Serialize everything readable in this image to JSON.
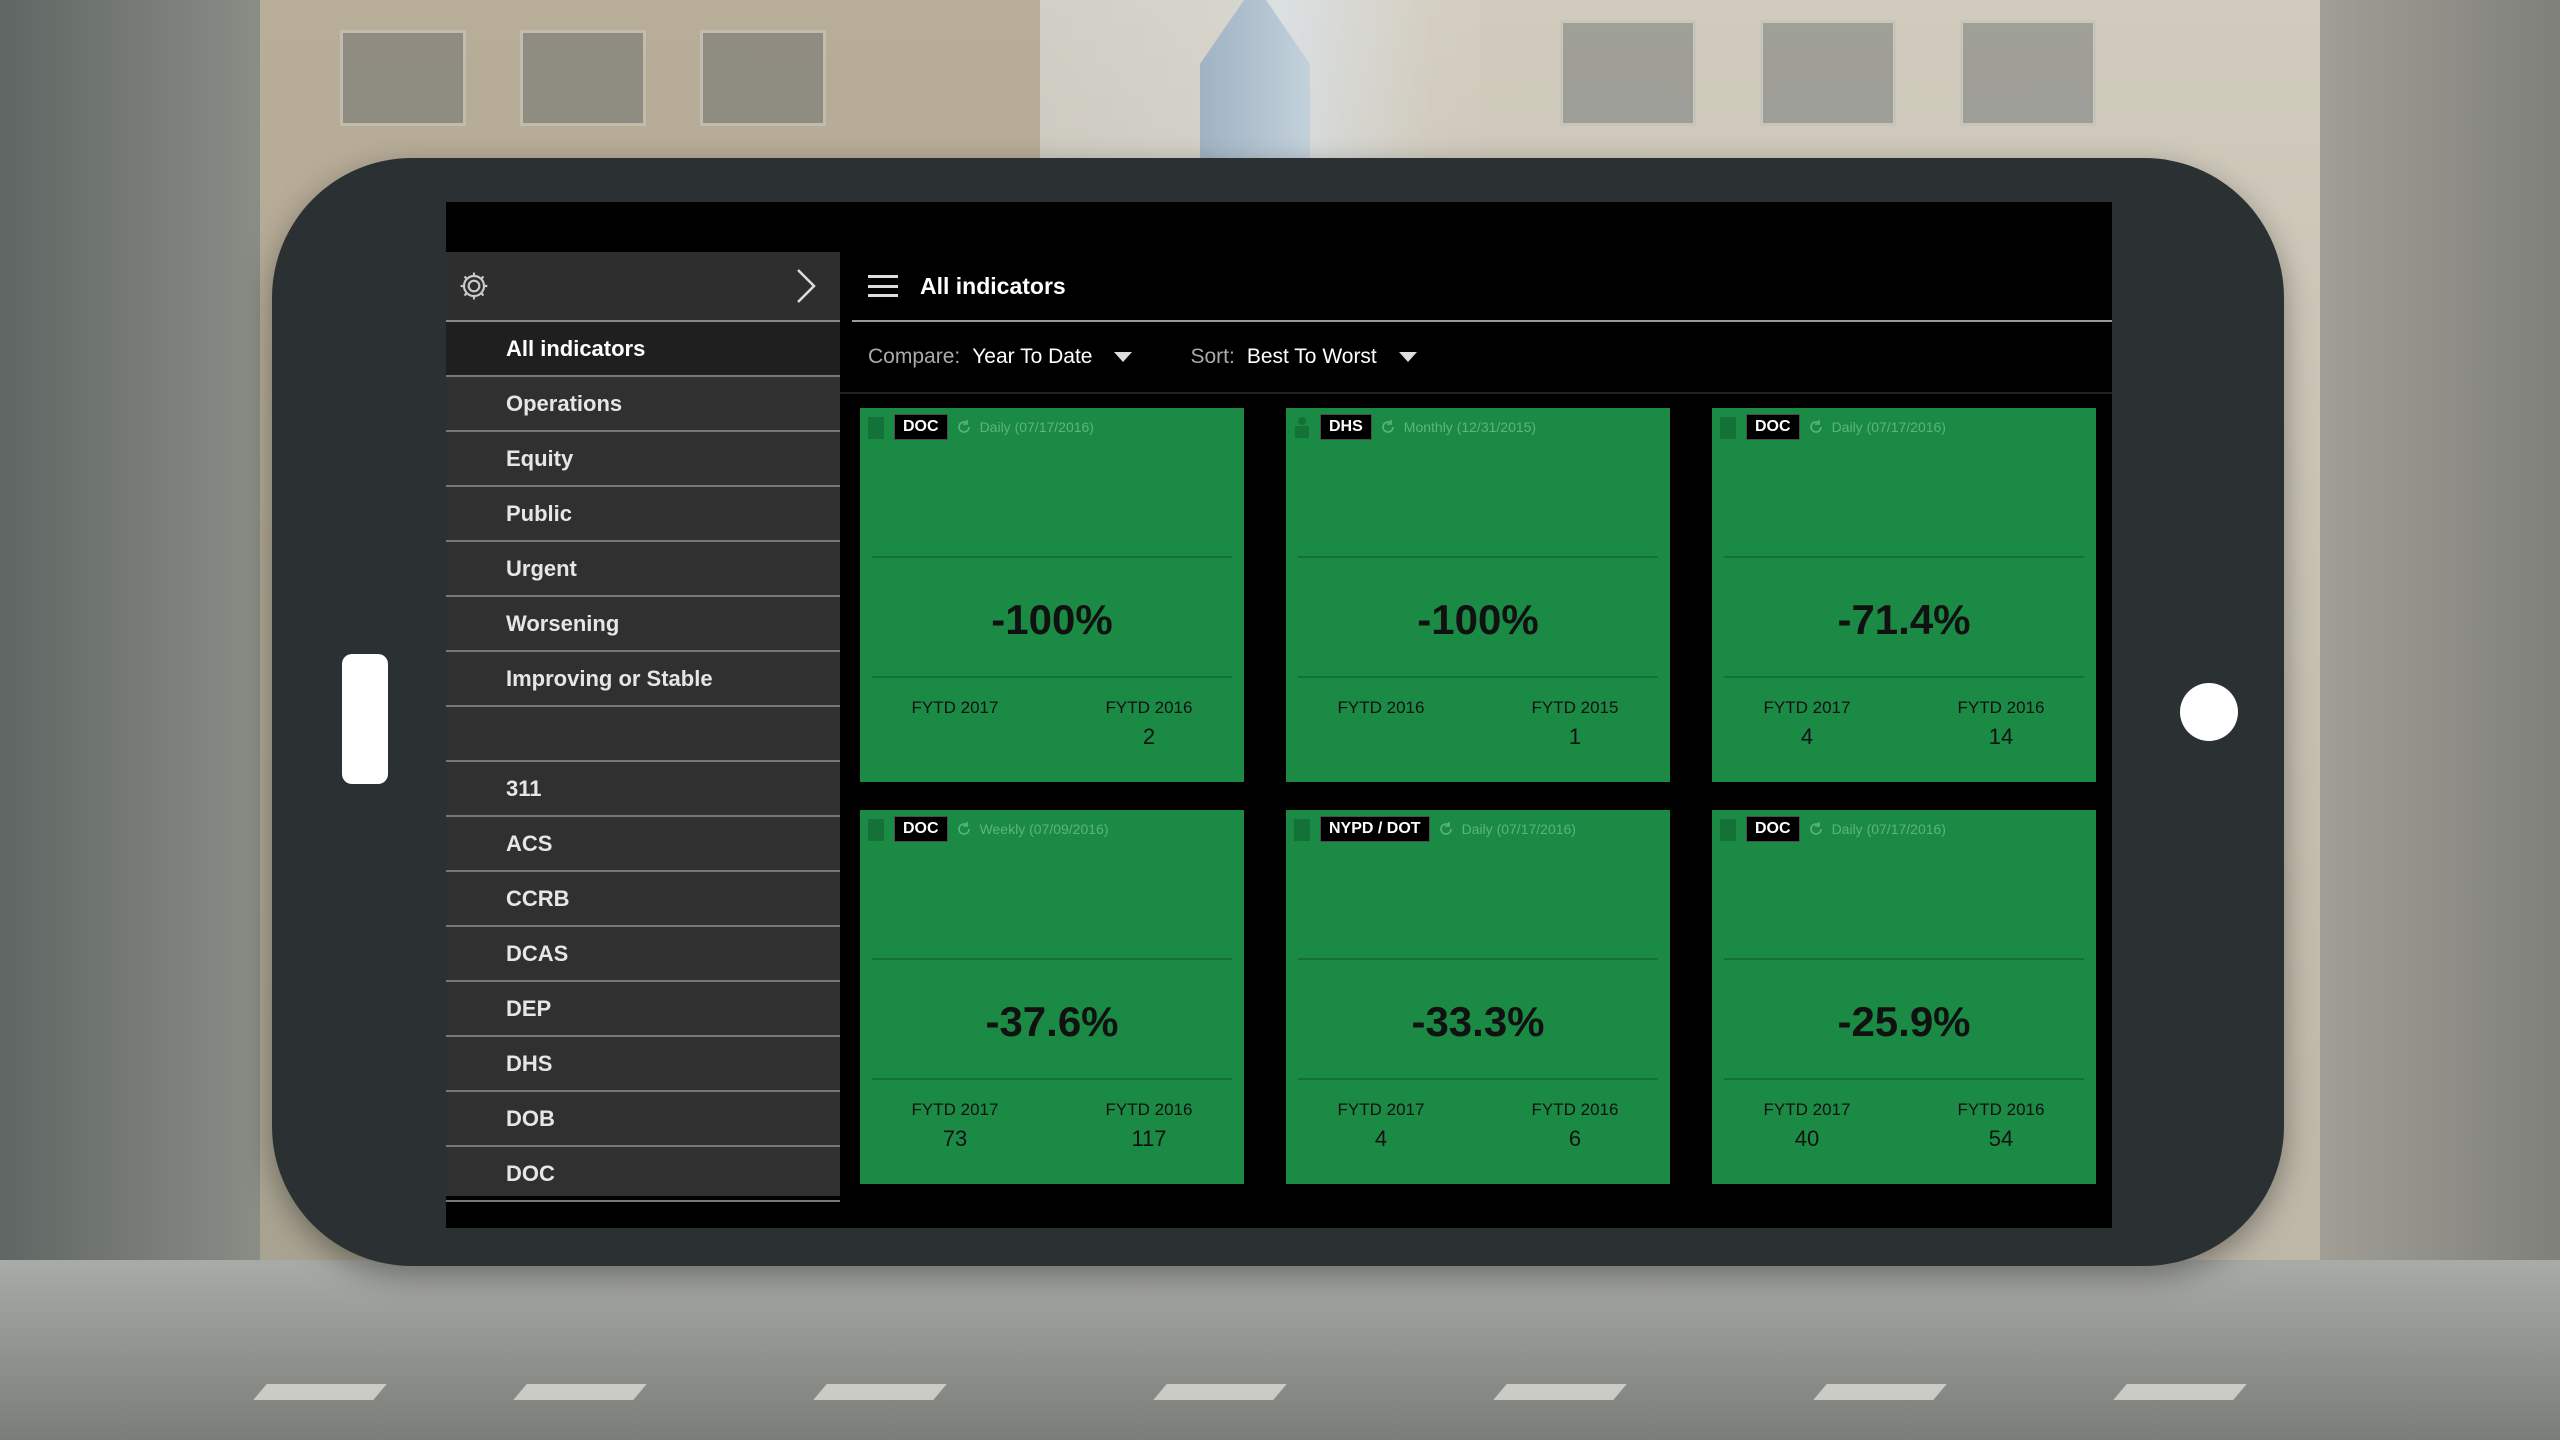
{
  "main": {
    "title": "All indicators",
    "compare_label": "Compare:",
    "compare_value": "Year To Date",
    "sort_label": "Sort:",
    "sort_value": "Best To Worst"
  },
  "sidebar": {
    "items": [
      {
        "label": "All indicators"
      },
      {
        "label": "Operations"
      },
      {
        "label": "Equity"
      },
      {
        "label": "Public"
      },
      {
        "label": "Urgent"
      },
      {
        "label": "Worsening"
      },
      {
        "label": "Improving or Stable"
      }
    ],
    "agencies": [
      {
        "label": "311"
      },
      {
        "label": "ACS"
      },
      {
        "label": "CCRB"
      },
      {
        "label": "DCAS"
      },
      {
        "label": "DEP"
      },
      {
        "label": "DHS"
      },
      {
        "label": "DOB"
      },
      {
        "label": "DOC"
      }
    ]
  },
  "cards": [
    {
      "agency": "DOC",
      "frequency": "Daily (07/17/2016)",
      "change": "-100%",
      "left_label": "FYTD 2017",
      "left_value": "",
      "right_label": "FYTD 2016",
      "right_value": "2"
    },
    {
      "agency": "DHS",
      "frequency": "Monthly (12/31/2015)",
      "change": "-100%",
      "left_label": "FYTD 2016",
      "left_value": "",
      "right_label": "FYTD 2015",
      "right_value": "1"
    },
    {
      "agency": "DOC",
      "frequency": "Daily (07/17/2016)",
      "change": "-71.4%",
      "left_label": "FYTD 2017",
      "left_value": "4",
      "right_label": "FYTD 2016",
      "right_value": "14"
    },
    {
      "agency": "DOC",
      "frequency": "Weekly (07/09/2016)",
      "change": "-37.6%",
      "left_label": "FYTD 2017",
      "left_value": "73",
      "right_label": "FYTD 2016",
      "right_value": "117"
    },
    {
      "agency": "NYPD / DOT",
      "frequency": "Daily (07/17/2016)",
      "change": "-33.3%",
      "left_label": "FYTD 2017",
      "left_value": "4",
      "right_label": "FYTD 2016",
      "right_value": "6"
    },
    {
      "agency": "DOC",
      "frequency": "Daily (07/17/2016)",
      "change": "-25.9%",
      "left_label": "FYTD 2017",
      "left_value": "40",
      "right_label": "FYTD 2016",
      "right_value": "54"
    }
  ],
  "colors": {
    "card": "#1a8a45",
    "sidebar": "#303030",
    "screen": "#000000"
  },
  "icons": [
    "gear-icon",
    "chevron-right-icon",
    "hamburger-icon",
    "caret-down-icon",
    "refresh-icon",
    "building-icon",
    "people-icon"
  ]
}
